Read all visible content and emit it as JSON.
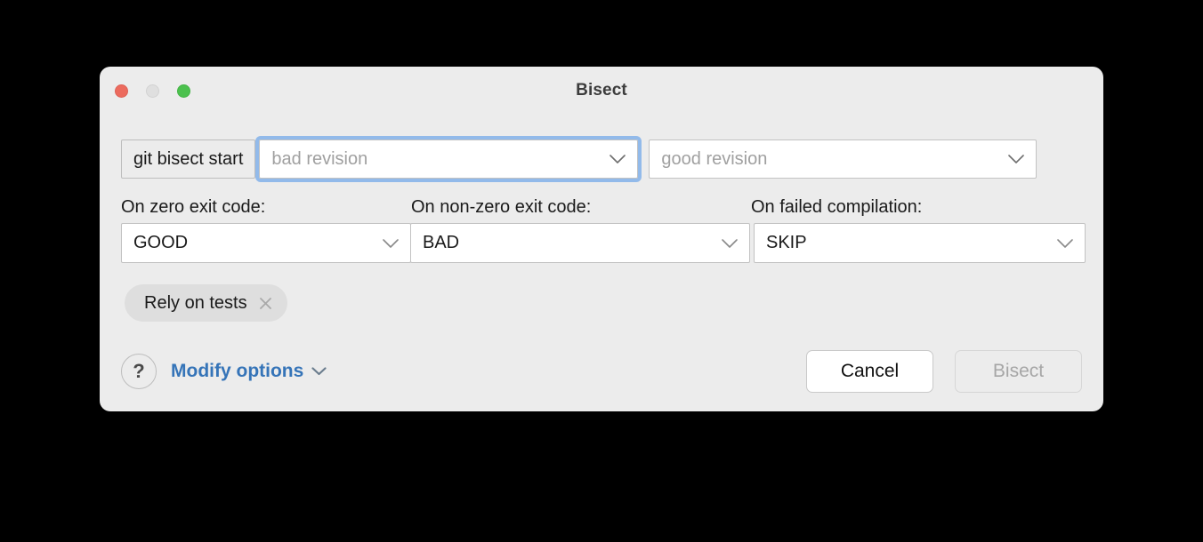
{
  "window": {
    "title": "Bisect",
    "traffic_lights": [
      {
        "name": "close",
        "color": "#EC6B5E"
      },
      {
        "name": "minimize",
        "color": "#DFDFDF"
      },
      {
        "name": "zoom",
        "color": "#4CC14E"
      }
    ]
  },
  "revision_row": {
    "command_prefix": "git bisect start",
    "bad_revision": {
      "placeholder": "bad revision",
      "value": "",
      "focused": true
    },
    "good_revision": {
      "placeholder": "good revision",
      "value": "",
      "focused": false
    }
  },
  "exit_code_options": [
    {
      "label": "On zero exit code:",
      "value": "GOOD"
    },
    {
      "label": "On non-zero exit code:",
      "value": "BAD"
    },
    {
      "label": "On failed compilation:",
      "value": "SKIP"
    }
  ],
  "chips": [
    {
      "label": "Rely on tests",
      "remove_icon": "close-icon"
    }
  ],
  "footer": {
    "help_label": "?",
    "modify_options_label": "Modify options",
    "cancel_label": "Cancel",
    "bisect_label": "Bisect",
    "bisect_disabled": true
  },
  "colors": {
    "dialog_background": "#ECECEC",
    "accent_link": "#3574B8",
    "focus_ring": "#92BAEA",
    "chip_background": "#DEDEDE",
    "page_background": "#000000"
  }
}
